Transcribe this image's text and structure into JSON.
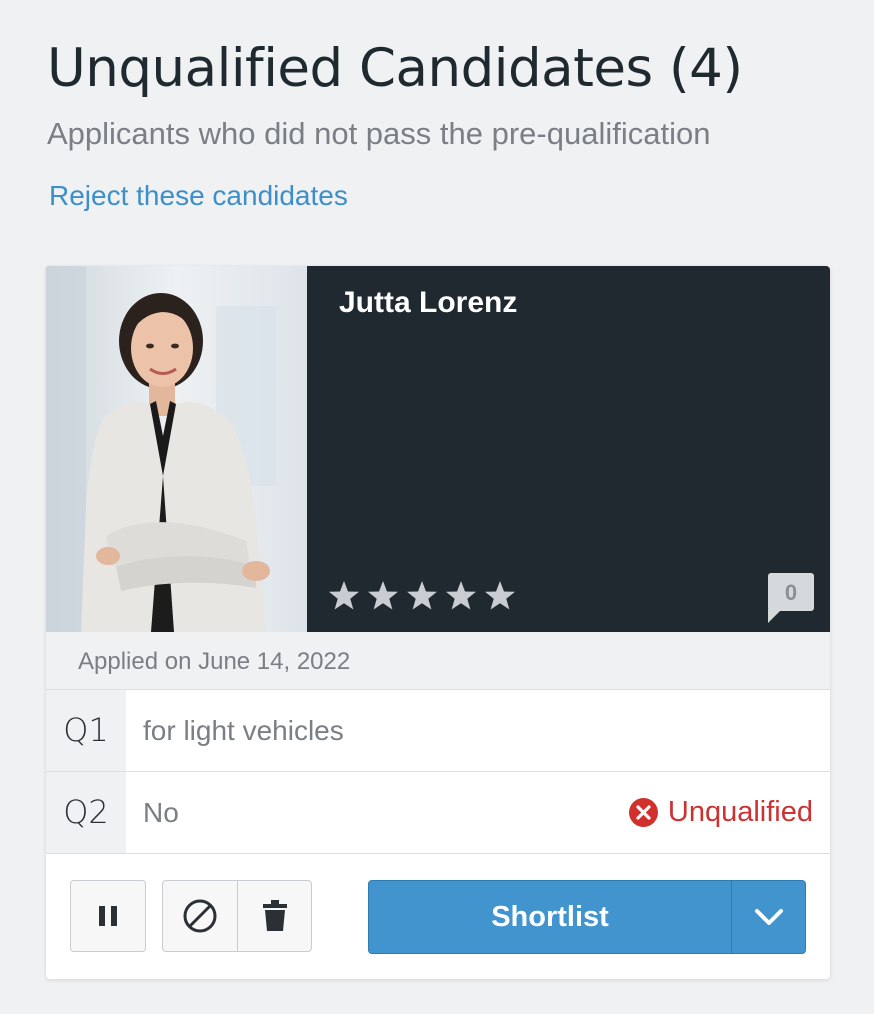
{
  "section": {
    "title": "Unqualified Candidates (4)",
    "subtitle": "Applicants who did not pass the pre-qualification",
    "reject_link": "Reject these candidates"
  },
  "candidate": {
    "name": "Jutta Lorenz",
    "rating": 0,
    "rating_max": 5,
    "comment_count": "0",
    "applied": "Applied on June 14, 2022",
    "questions": [
      {
        "label": "Q1",
        "answer": "for light vehicles",
        "status": ""
      },
      {
        "label": "Q2",
        "answer": "No",
        "status": "Unqualified"
      }
    ]
  },
  "actions": {
    "shortlist_label": "Shortlist"
  },
  "colors": {
    "accent": "#4194cd",
    "link": "#3d8fc7",
    "danger": "#cc3232",
    "card_header": "#1f292f"
  },
  "icons": [
    "star-icon",
    "comment-icon",
    "x-circle-icon",
    "pause-icon",
    "block-icon",
    "trash-icon",
    "chevron-down-icon"
  ]
}
